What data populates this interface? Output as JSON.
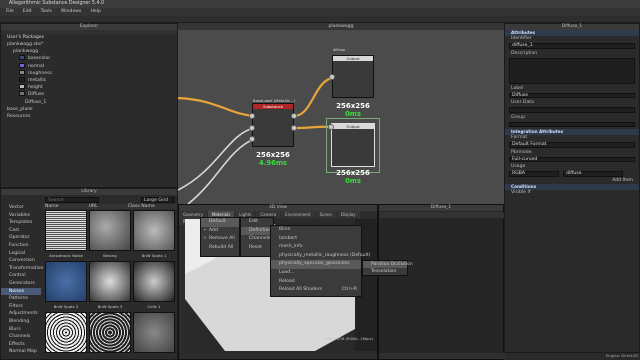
{
  "app": {
    "title": "Allegorithmic Substance Designer 5.4.0"
  },
  "menu": [
    "File",
    "Edit",
    "Tools",
    "Windows",
    "Help"
  ],
  "explorer": {
    "title": "Explorer",
    "pkg_header": "User's Packages",
    "items": [
      {
        "label": "plankwogg.sbs*",
        "indent": 1
      },
      {
        "label": "plankwogg",
        "indent": 2
      },
      {
        "label": "basecolor",
        "indent": 3,
        "swatch": "#3a4a7a"
      },
      {
        "label": "normal",
        "indent": 3,
        "swatch": "#6a6ad0"
      },
      {
        "label": "roughness",
        "indent": 3,
        "swatch": "#888888"
      },
      {
        "label": "metallic",
        "indent": 3,
        "swatch": "#222222"
      },
      {
        "label": "height",
        "indent": 3,
        "swatch": "#bbbbbb"
      },
      {
        "label": "Diffuse",
        "indent": 3,
        "swatch": "#777777"
      },
      {
        "label": "Diffuse_1",
        "indent": 4
      },
      {
        "label": "base_plank",
        "indent": 1
      },
      {
        "label": "Resources",
        "indent": 1
      }
    ]
  },
  "graph": {
    "title": "plankwogg",
    "main_node": {
      "title": "Substance",
      "subtitle": "BaseLabel (Metallic...)",
      "size": "256x256",
      "time": "4.96ms",
      "color": "#b02626"
    },
    "out1": {
      "title": "Output",
      "label": "diffuse",
      "size": "256x256",
      "time": "0ms"
    },
    "out2": {
      "title": "Output",
      "label": "diffuse_1",
      "size": "256x256",
      "time": "0ms"
    }
  },
  "library": {
    "title": "Library",
    "search_placeholder": "Search",
    "filter_label": "Large Grid",
    "categories": [
      "Vector",
      "Variables",
      "Templates",
      "Cast",
      "Operator",
      "Function",
      "Logical",
      "Conversion",
      "Transformation",
      "Control",
      "Generators",
      "Noises",
      "Patterns",
      "Filters",
      "Adjustments",
      "Blending",
      "Blurs",
      "Channels",
      "Effects",
      "Normal Map"
    ],
    "active_category": 11,
    "columns": [
      "Name",
      "URL",
      "Class Name"
    ],
    "thumbs": [
      "Anisotropic Noise",
      "Belong",
      "BnW Spots 1",
      "BnW Spots 2",
      "BnW Spots 3",
      "Cells 1",
      "",
      "",
      ""
    ]
  },
  "view3d": {
    "title": "3D View",
    "tabs": [
      "Geometry",
      "Materials",
      "Lights",
      "Camera",
      "Environment",
      "Scene",
      "Display",
      "Renderer"
    ],
    "status": "256 x 256 (RGBA, 16bpc)"
  },
  "ctx": {
    "m1": [
      "Default",
      "Add",
      "Remove All",
      "Rebuild All"
    ],
    "m2": [
      "Edit",
      "Channels",
      "Reset"
    ],
    "m3": [
      "Definitions"
    ],
    "m4": [
      "Blinn",
      "lambert",
      "mesh_info",
      "physically_metallic_roughness (Default)",
      "physically_specular_glossiness",
      "Load...",
      "Reload",
      "Reload All Shaders"
    ],
    "m4_shortcut": "Ctrl+R",
    "m5": [
      "Parallax Occlusion",
      "Tesselation"
    ]
  },
  "view2d": {
    "title": "Diffuse_1"
  },
  "attributes": {
    "title": "Diffuse_1",
    "header": "Attributes",
    "identifier_label": "Identifier",
    "identifier": "diffuse_1",
    "description_label": "Description",
    "label_label": "Label",
    "label": "Diffuse",
    "userdata_label": "User Data",
    "group_label": "Group",
    "integration": "Integration Attributes",
    "format_label": "Format",
    "format": "Default Format",
    "pbrmode_label": "Pbrmode",
    "pbrmode": "Full-curved",
    "usage_label": "Usage",
    "usage": "RGBA",
    "usage2": "diffuse",
    "add_item": "Add Item",
    "conditions": "Conditions",
    "visible_label": "Visible If"
  },
  "statusbar": {
    "engine": "Engine: Direct3D"
  }
}
